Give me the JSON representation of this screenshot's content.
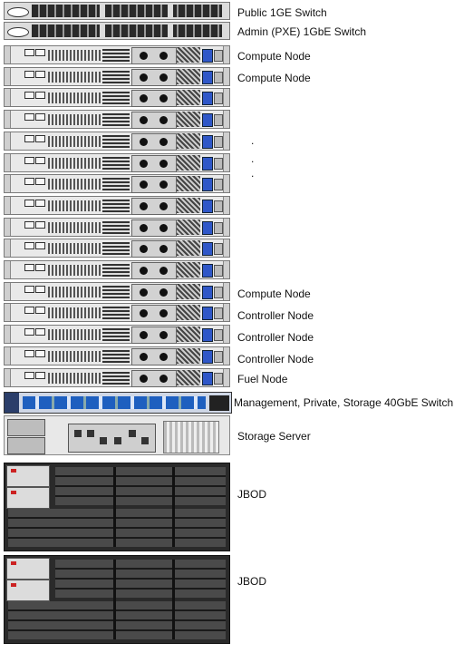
{
  "labels": {
    "public_switch": "Public 1GE Switch",
    "admin_switch": "Admin (PXE) 1GbE Switch",
    "compute_1": "Compute  Node",
    "compute_2": "Compute  Node",
    "compute_last": "Compute  Node",
    "controller_1": "Controller  Node",
    "controller_2": "Controller  Node",
    "controller_3": "Controller  Node",
    "fuel": "Fuel Node",
    "mgmt_switch": "Management, Private, Storage 40GbE Switch",
    "storage_server": "Storage Server",
    "jbod_1": "JBOD",
    "jbod_2": "JBOD"
  },
  "ellipsis_dots": [
    ".",
    ".",
    "."
  ],
  "colors": {
    "switch_port": "#2a2a2a",
    "psu_blue": "#2f57c8",
    "switch40_port": "#1e5fbf",
    "jbod_body": "#2a2a2a"
  }
}
